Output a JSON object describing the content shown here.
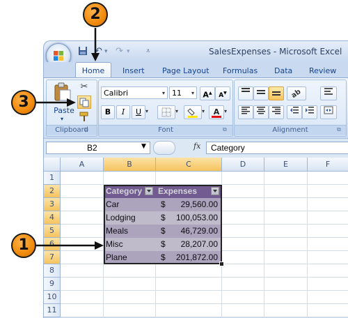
{
  "window": {
    "title": "SalesExpenses - Microsoft Excel"
  },
  "tabs": [
    "Home",
    "Insert",
    "Page Layout",
    "Formulas",
    "Data",
    "Review"
  ],
  "ribbon": {
    "clipboard": {
      "paste_label": "Paste",
      "group_label": "Clipboard"
    },
    "font": {
      "font_name": "Calibri",
      "font_size": "11",
      "bold": "B",
      "italic": "I",
      "underline": "U",
      "group_label": "Font"
    },
    "alignment": {
      "group_label": "Alignment"
    }
  },
  "formula_bar": {
    "name_box": "B2",
    "fx": "fx",
    "content": "Category"
  },
  "grid": {
    "columns": [
      "A",
      "B",
      "C",
      "D",
      "E",
      "F"
    ],
    "rows": [
      "1",
      "2",
      "3",
      "4",
      "5",
      "6",
      "7",
      "8",
      "9",
      "10",
      "11"
    ],
    "table": {
      "headers": [
        "Category",
        "Expenses"
      ],
      "currency_symbol": "$",
      "rows": [
        {
          "category": "Car",
          "amount": "29,560.00"
        },
        {
          "category": "Lodging",
          "amount": "100,053.00"
        },
        {
          "category": "Meals",
          "amount": "46,729.00"
        },
        {
          "category": "Misc",
          "amount": "28,207.00"
        },
        {
          "category": "Plane",
          "amount": "201,872.00"
        }
      ]
    }
  },
  "callouts": {
    "one": "1",
    "two": "2",
    "three": "3"
  },
  "colors": {
    "header_purple": "#8064a2",
    "band_dark": "#ccc0da",
    "band_light": "#e4dfec",
    "callout_orange": "#f08a0c"
  },
  "icons": [
    "office-button-logo",
    "save-icon",
    "undo-icon",
    "redo-icon",
    "customize-qat-icon",
    "cut-icon",
    "copy-icon",
    "format-painter-icon",
    "paste-icon",
    "grow-font-icon",
    "shrink-font-icon",
    "borders-icon",
    "fill-color-icon",
    "font-color-icon",
    "align-top-icon",
    "align-middle-icon",
    "align-bottom-icon",
    "orientation-icon",
    "align-left-icon",
    "center-icon",
    "align-right-icon",
    "decrease-indent-icon",
    "increase-indent-icon",
    "wrap-text-icon",
    "merge-icon",
    "filter-dropdown-icon"
  ]
}
